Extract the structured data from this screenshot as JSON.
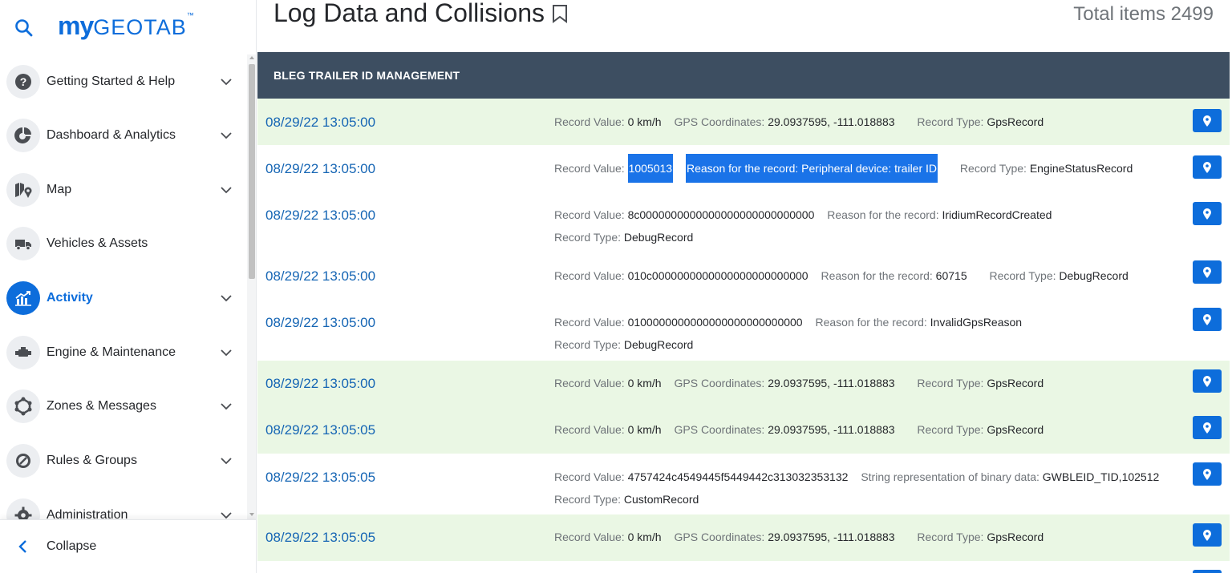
{
  "brand": {
    "logo_my": "my",
    "logo_geotab": "GEOTAB",
    "logo_tm": "™"
  },
  "nav": {
    "items": [
      {
        "label": "Getting Started & Help",
        "icon": "help-icon"
      },
      {
        "label": "Dashboard & Analytics",
        "icon": "pie-chart-icon"
      },
      {
        "label": "Map",
        "icon": "map-icon"
      },
      {
        "label": "Vehicles & Assets",
        "icon": "truck-icon"
      },
      {
        "label": "Activity",
        "icon": "activity-chart-icon",
        "active": true
      },
      {
        "label": "Engine & Maintenance",
        "icon": "engine-icon"
      },
      {
        "label": "Zones & Messages",
        "icon": "zones-icon"
      },
      {
        "label": "Rules & Groups",
        "icon": "rules-icon"
      },
      {
        "label": "Administration",
        "icon": "gear-icon"
      }
    ],
    "collapse_label": "Collapse"
  },
  "page": {
    "title": "Log Data and Collisions",
    "total_label": "Total items 2499",
    "group_header": "BLEG TRAILER ID MANAGEMENT"
  },
  "colors": {
    "accent": "#0d6ddb",
    "header_band": "#3d4e61",
    "row_green": "#eaf7e4",
    "highlight": "#1a73e8"
  },
  "rows": [
    {
      "timestamp": "08/29/22 13:05:00",
      "line1": [
        [
          "Record Value: ",
          "0 km/h"
        ],
        [
          "GPS Coordinates: ",
          "29.0937595, -111.018883"
        ],
        [
          "Record Type: ",
          "GpsRecord"
        ]
      ]
    },
    {
      "timestamp": "08/29/22 13:05:00",
      "line1_value_label": "Record Value: ",
      "line1_value": "1005013",
      "line1_reason": "Reason for the record: Peripheral device: trailer ID",
      "line1_type_label": "Record Type: ",
      "line1_type": "EngineStatusRecord"
    },
    {
      "timestamp": "08/29/22 13:05:00",
      "line1": [
        [
          "Record Value: ",
          "8c0000000000000000000000000000"
        ],
        [
          "Reason for the record: ",
          "IridiumRecordCreated"
        ]
      ],
      "line2": [
        [
          "Record Type: ",
          "DebugRecord"
        ]
      ]
    },
    {
      "timestamp": "08/29/22 13:05:00",
      "line1": [
        [
          "Record Value: ",
          "010c0000000000000000000000000"
        ],
        [
          "Reason for the record: ",
          "60715"
        ],
        [
          "Record Type: ",
          "DebugRecord"
        ]
      ]
    },
    {
      "timestamp": "08/29/22 13:05:00",
      "line1": [
        [
          "Record Value: ",
          "0100000000000000000000000000"
        ],
        [
          "Reason for the record: ",
          "InvalidGpsReason"
        ]
      ],
      "line2": [
        [
          "Record Type: ",
          "DebugRecord"
        ]
      ]
    },
    {
      "timestamp": "08/29/22 13:05:00",
      "line1": [
        [
          "Record Value: ",
          "0 km/h"
        ],
        [
          "GPS Coordinates: ",
          "29.0937595, -111.018883"
        ],
        [
          "Record Type: ",
          "GpsRecord"
        ]
      ]
    },
    {
      "timestamp": "08/29/22 13:05:05",
      "line1": [
        [
          "Record Value: ",
          "0 km/h"
        ],
        [
          "GPS Coordinates: ",
          "29.0937595, -111.018883"
        ],
        [
          "Record Type: ",
          "GpsRecord"
        ]
      ]
    },
    {
      "timestamp": "08/29/22 13:05:05",
      "line1": [
        [
          "Record Value: ",
          "4757424c4549445f5449442c313032353132"
        ],
        [
          "String representation of binary data: ",
          "GWBLEID_TID,102512"
        ]
      ],
      "line2": [
        [
          "Record Type: ",
          "CustomRecord"
        ]
      ]
    },
    {
      "timestamp": "08/29/22 13:05:05",
      "line1": [
        [
          "Record Value: ",
          "0 km/h"
        ],
        [
          "GPS Coordinates: ",
          "29.0937595, -111.018883"
        ],
        [
          "Record Type: ",
          "GpsRecord"
        ]
      ]
    }
  ]
}
